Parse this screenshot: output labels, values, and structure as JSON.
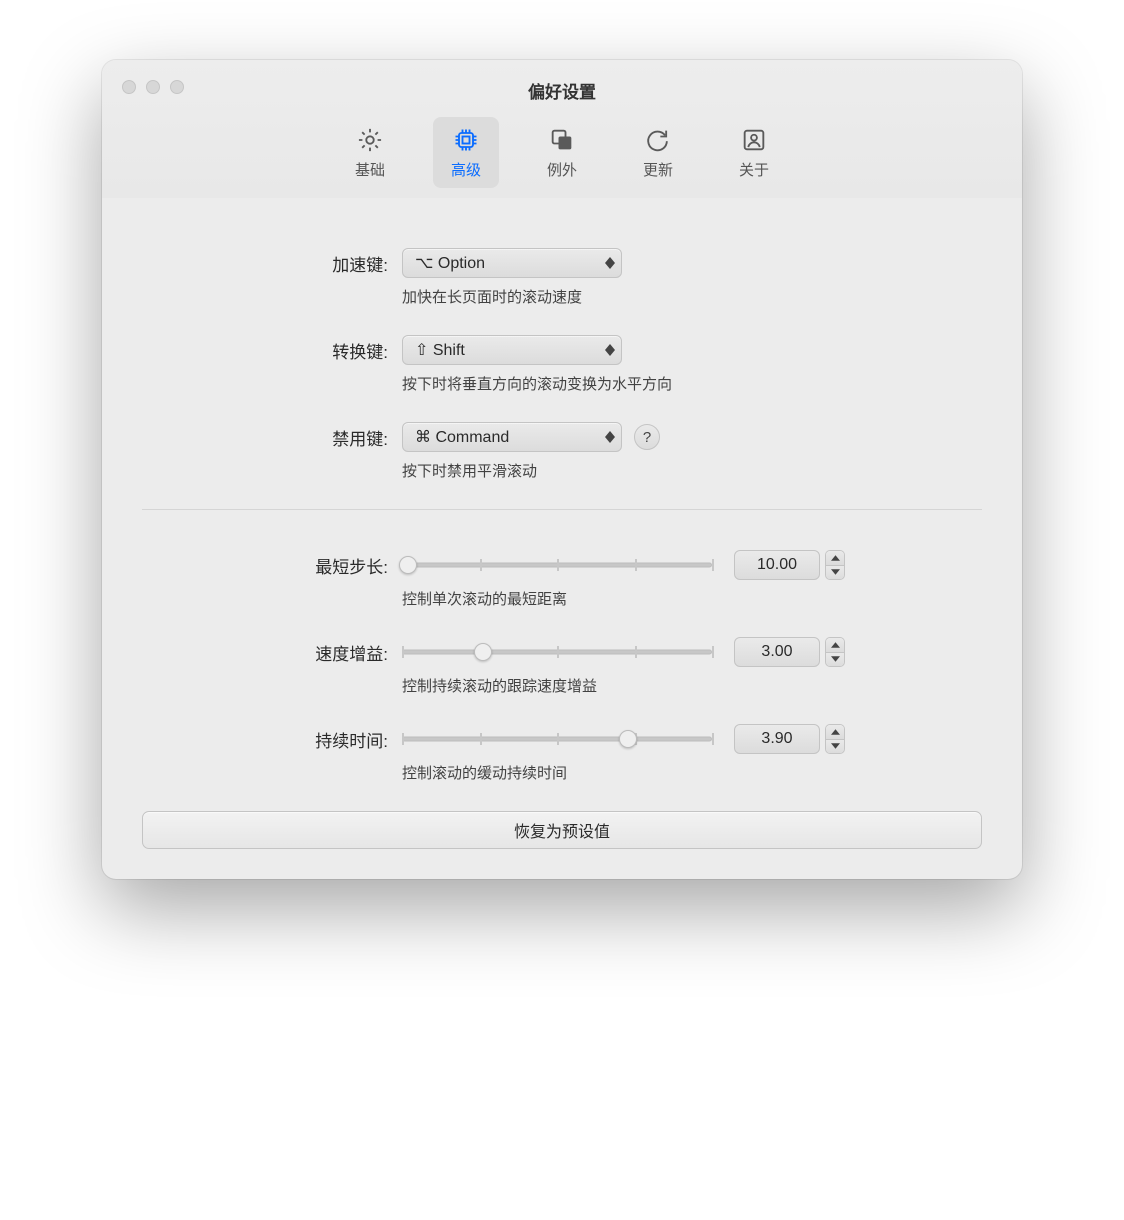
{
  "window": {
    "title": "偏好设置"
  },
  "tabs": {
    "basic": "基础",
    "advanced": "高级",
    "exceptions": "例外",
    "updates": "更新",
    "about": "关于",
    "active": "advanced"
  },
  "keys": {
    "accel": {
      "label": "加速键:",
      "value": "⌥ Option",
      "desc": "加快在长页面时的滚动速度"
    },
    "toggle": {
      "label": "转换键:",
      "value": "⇧ Shift",
      "desc": "按下时将垂直方向的滚动变换为水平方向"
    },
    "block": {
      "label": "禁用键:",
      "value": "⌘ Command",
      "desc": "按下时禁用平滑滚动",
      "help": "?"
    }
  },
  "sliders": {
    "minStep": {
      "label": "最短步长:",
      "value": "10.00",
      "desc": "控制单次滚动的最短距离",
      "pos": 0.02
    },
    "speedGain": {
      "label": "速度增益:",
      "value": "3.00",
      "desc": "控制持续滚动的跟踪速度增益",
      "pos": 0.26
    },
    "duration": {
      "label": "持续时间:",
      "value": "3.90",
      "desc": "控制滚动的缓动持续时间",
      "pos": 0.73
    }
  },
  "reset": {
    "label": "恢复为预设值"
  }
}
